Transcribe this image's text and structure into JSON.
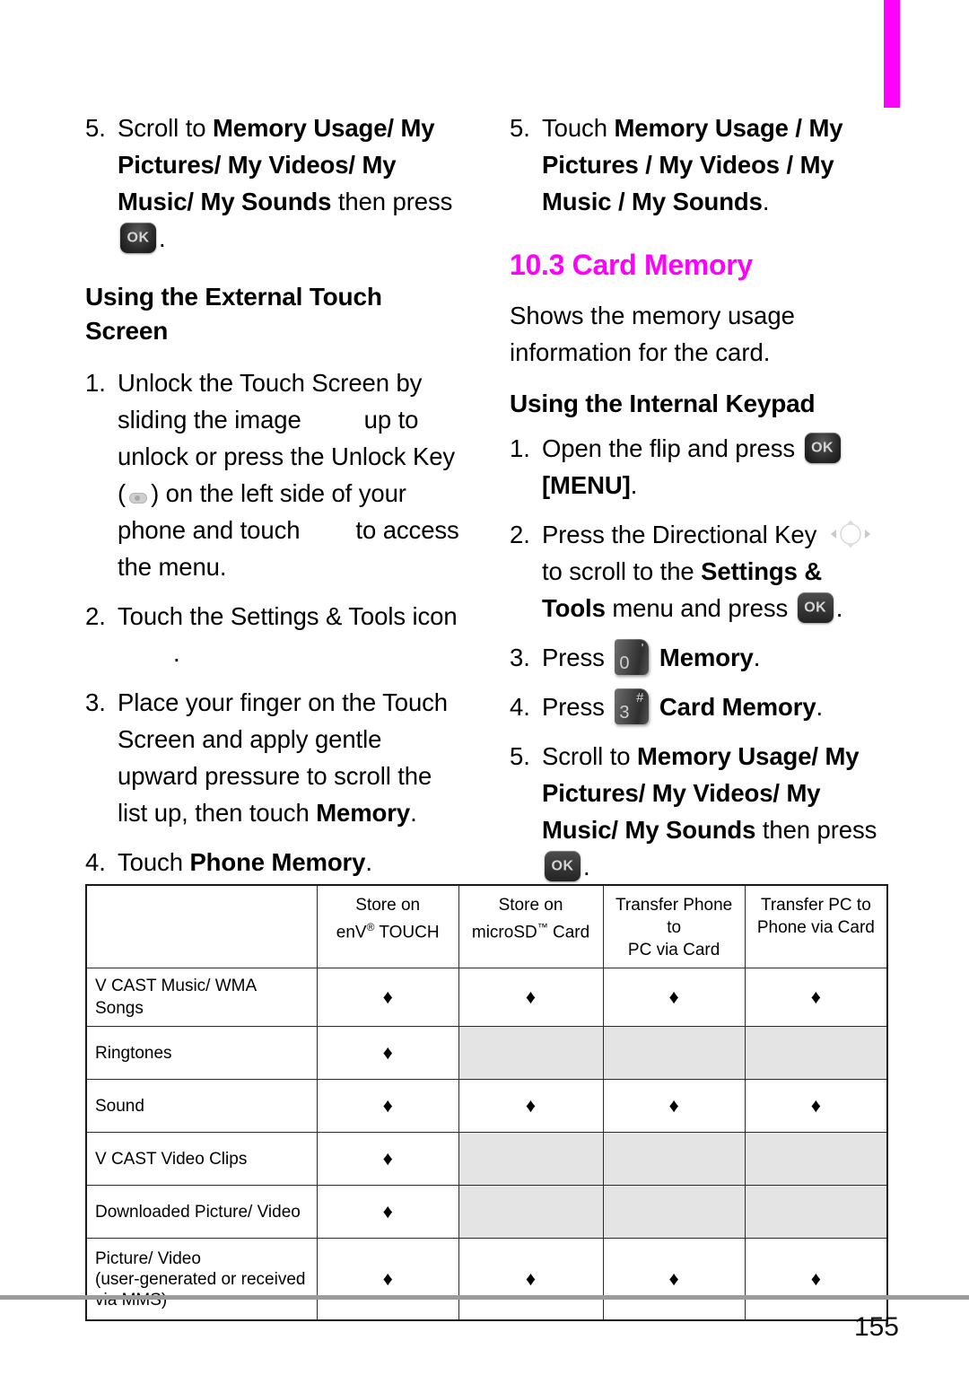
{
  "page": {
    "number": "155",
    "accent_color": "#ff00ff",
    "chapter_tab": "chapter-tab-marker"
  },
  "left_column": {
    "step5": {
      "num": "5.",
      "lead": "Scroll to ",
      "bold": "Memory Usage/ My Pictures/ My Videos/ My Music/ My Sounds",
      "mid": " then press ",
      "key": "ok-key",
      "tail": "."
    },
    "heading_touch_screen": "Using the External Touch Screen",
    "step1": {
      "num": "1.",
      "t1": "Unlock the Touch Screen by sliding the image",
      "t2": "up to unlock or press the Unlock Key",
      "t3": "(",
      "t4": ") on the left side of your phone and touch",
      "t5": "to access the menu."
    },
    "step2": {
      "num": "2.",
      "t1": "Touch the Settings & Tools icon",
      "t2": "."
    },
    "step3": {
      "num": "3.",
      "lead": "Place your finger on the Touch Screen and apply gentle upward pressure to scroll the list up, then touch ",
      "bold": "Memory",
      "tail": "."
    },
    "step4": {
      "num": "4.",
      "lead": "Touch ",
      "bold": "Phone Memory",
      "tail": "."
    }
  },
  "right_column": {
    "step5_top": {
      "num": "5.",
      "lead": "Touch ",
      "bold": "Memory Usage / My Pictures / My Videos / My Music / My Sounds",
      "tail": "."
    },
    "chapter_heading": "10.3 Card Memory",
    "intro": "Shows the memory usage information for the card.",
    "heading_keypad": "Using the Internal Keypad",
    "step1": {
      "num": "1.",
      "lead": "Open the flip and press ",
      "key": "ok-key",
      "bold": "[MENU]",
      "tail": "."
    },
    "step2": {
      "num": "2.",
      "lead": "Press the Directional Key ",
      "key_dir": "directional-key",
      "mid": " to scroll to the ",
      "bold": "Settings & Tools",
      "mid2": " menu and press ",
      "key_ok": "ok-key",
      "tail": "."
    },
    "step3": {
      "num": "3.",
      "lead": "Press ",
      "key_digit": "0",
      "key_mark": "'",
      "bold": "Memory",
      "tail": "."
    },
    "step4": {
      "num": "4.",
      "lead": "Press ",
      "key_digit": "3",
      "key_mark": "#",
      "bold": "Card Memory",
      "tail": "."
    },
    "step5_bottom": {
      "num": "5.",
      "lead": "Scroll to ",
      "bold": "Memory Usage/ My Pictures/ My Videos/ My Music/ My Sounds",
      "mid": " then press ",
      "key": "ok-key",
      "tail": "."
    }
  },
  "table": {
    "headers": [
      "",
      {
        "line1": "Store on",
        "line2_pre": "enV",
        "line2_sup": "®",
        "line2_post": " TOUCH"
      },
      {
        "line1": "Store on",
        "line2_pre": "microSD",
        "line2_sup": "™",
        "line2_post": " Card"
      },
      {
        "line1": "Transfer Phone to",
        "line2": "PC via Card"
      },
      {
        "line1": "Transfer PC to",
        "line2": "Phone via Card"
      }
    ],
    "mark": "♦",
    "rows": [
      {
        "label": "V CAST Music/ WMA Songs",
        "cells": [
          true,
          true,
          true,
          true
        ]
      },
      {
        "label": "Ringtones",
        "cells": [
          true,
          false,
          false,
          false
        ]
      },
      {
        "label": "Sound",
        "cells": [
          true,
          true,
          true,
          true
        ]
      },
      {
        "label": "V CAST Video Clips",
        "cells": [
          true,
          false,
          false,
          false
        ]
      },
      {
        "label": "Downloaded Picture/ Video",
        "cells": [
          true,
          false,
          false,
          false
        ]
      },
      {
        "label": "Picture/ Video\n(user-generated or received\nvia MMS)",
        "cells": [
          true,
          true,
          true,
          true
        ]
      }
    ]
  }
}
